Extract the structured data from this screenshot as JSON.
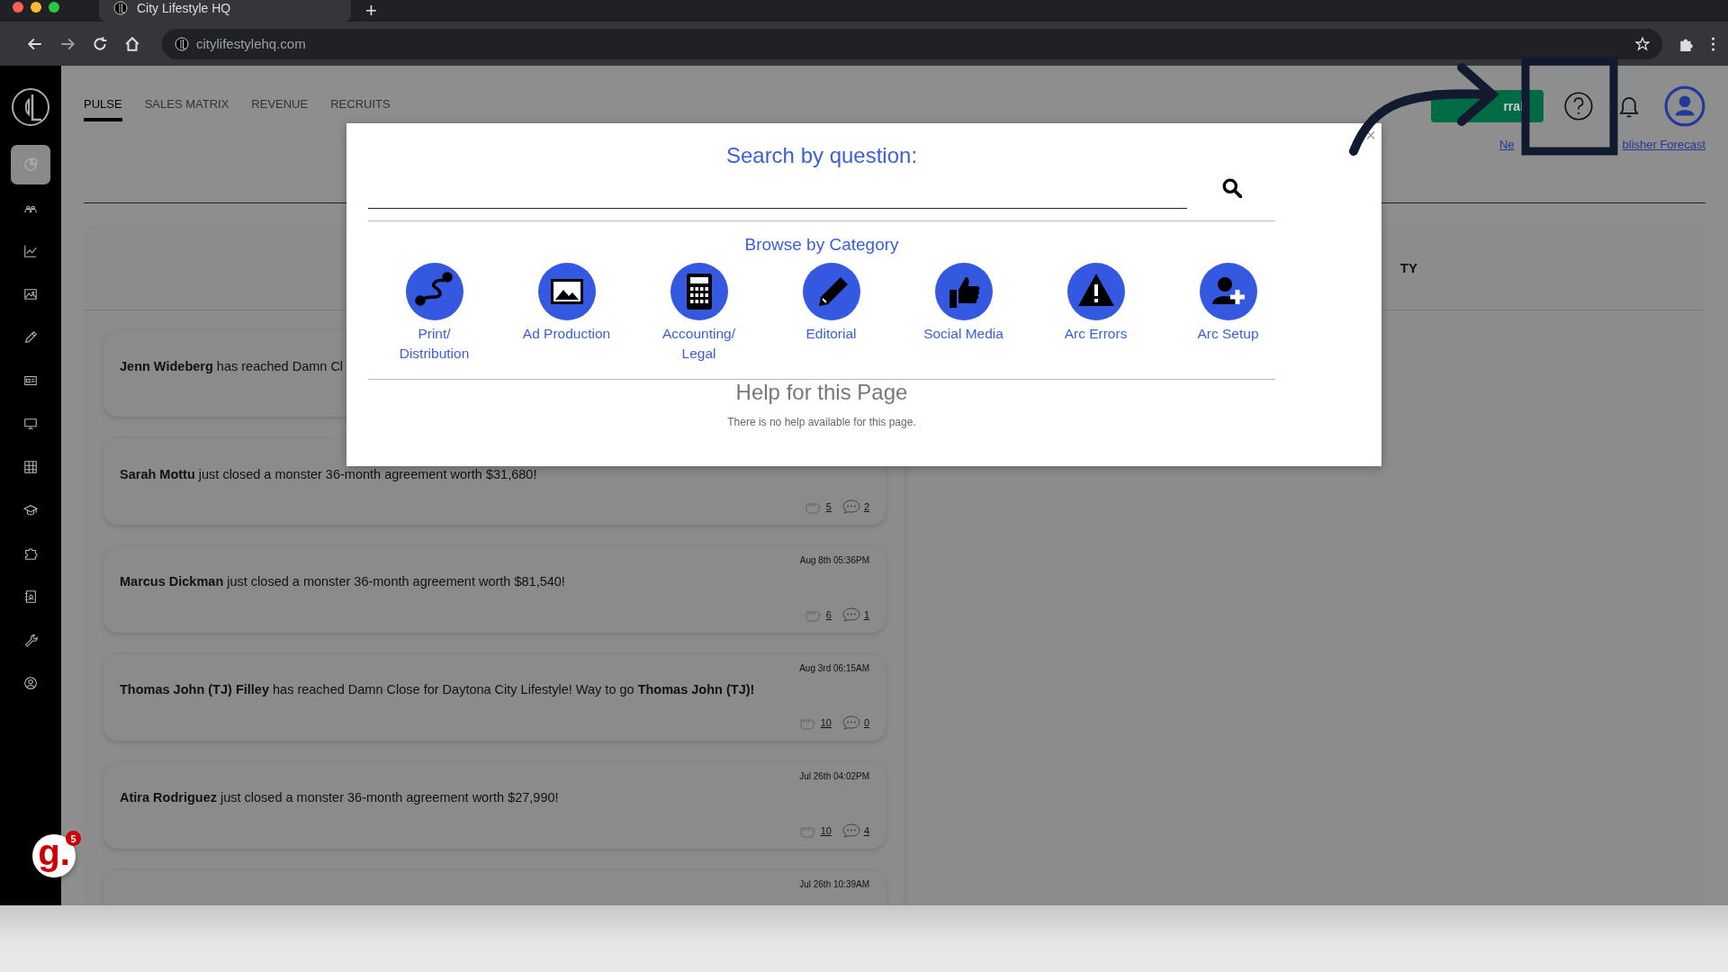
{
  "browser": {
    "tab_title": "City Lifestyle HQ",
    "new_tab": "+",
    "url": "citylifestylehq.com"
  },
  "sidebar": {
    "items": [
      {
        "selected": true
      },
      {
        "selected": false
      },
      {
        "selected": false
      },
      {
        "selected": false
      },
      {
        "selected": false
      },
      {
        "selected": false
      },
      {
        "selected": false
      },
      {
        "selected": false
      },
      {
        "selected": false
      },
      {
        "selected": false
      },
      {
        "selected": false
      },
      {
        "selected": false
      },
      {
        "selected": false
      }
    ]
  },
  "chat_widget": {
    "logo": "g.",
    "count": "5"
  },
  "nav_tabs": [
    {
      "label": "PULSE",
      "selected": true
    },
    {
      "label": "SALES MATRIX",
      "selected": false
    },
    {
      "label": "REVENUE",
      "selected": false
    },
    {
      "label": "RECRUITS",
      "selected": false
    }
  ],
  "header": {
    "button": "rral",
    "links": [
      "Ne",
      "blisher Forecast"
    ]
  },
  "panel_heading": "TY",
  "feed": [
    {
      "text": "**Jenn Wideberg** has reached Damn Cl"
    },
    {
      "text": "**Sarah Mottu** just closed a monster 36-month agreement worth $31,680!",
      "fists": "5",
      "comments": "2"
    },
    {
      "time": "Aug 8th 05:36PM",
      "text": "**Marcus Dickman** just closed a monster 36-month agreement worth $81,540!",
      "fists": "6",
      "comments": "1"
    },
    {
      "time": "Aug 3rd 06:15AM",
      "text": "**Thomas John (TJ) Filley** has reached Damn Close for Daytona City Lifestyle! Way to go **Thomas John (TJ)!**",
      "fists": "10",
      "comments": "0"
    },
    {
      "time": "Jul 26th 04:02PM",
      "text": "**Atira Rodriguez** just closed a monster 36-month agreement worth $27,990!",
      "fists": "10",
      "comments": "4"
    },
    {
      "time": "Jul 26th 10:39AM"
    }
  ],
  "modal": {
    "close": "×",
    "title": "Search by question:",
    "browse_title": "Browse by Category",
    "categories": [
      {
        "label": "Print/\nDistribution"
      },
      {
        "label": "Ad Production"
      },
      {
        "label": "Accounting/\nLegal"
      },
      {
        "label": "Editorial"
      },
      {
        "label": "Social Media"
      },
      {
        "label": "Arc Errors"
      },
      {
        "label": "Arc Setup"
      }
    ],
    "help_title": "Help for this Page",
    "help_text": "There is no help available for this page."
  }
}
